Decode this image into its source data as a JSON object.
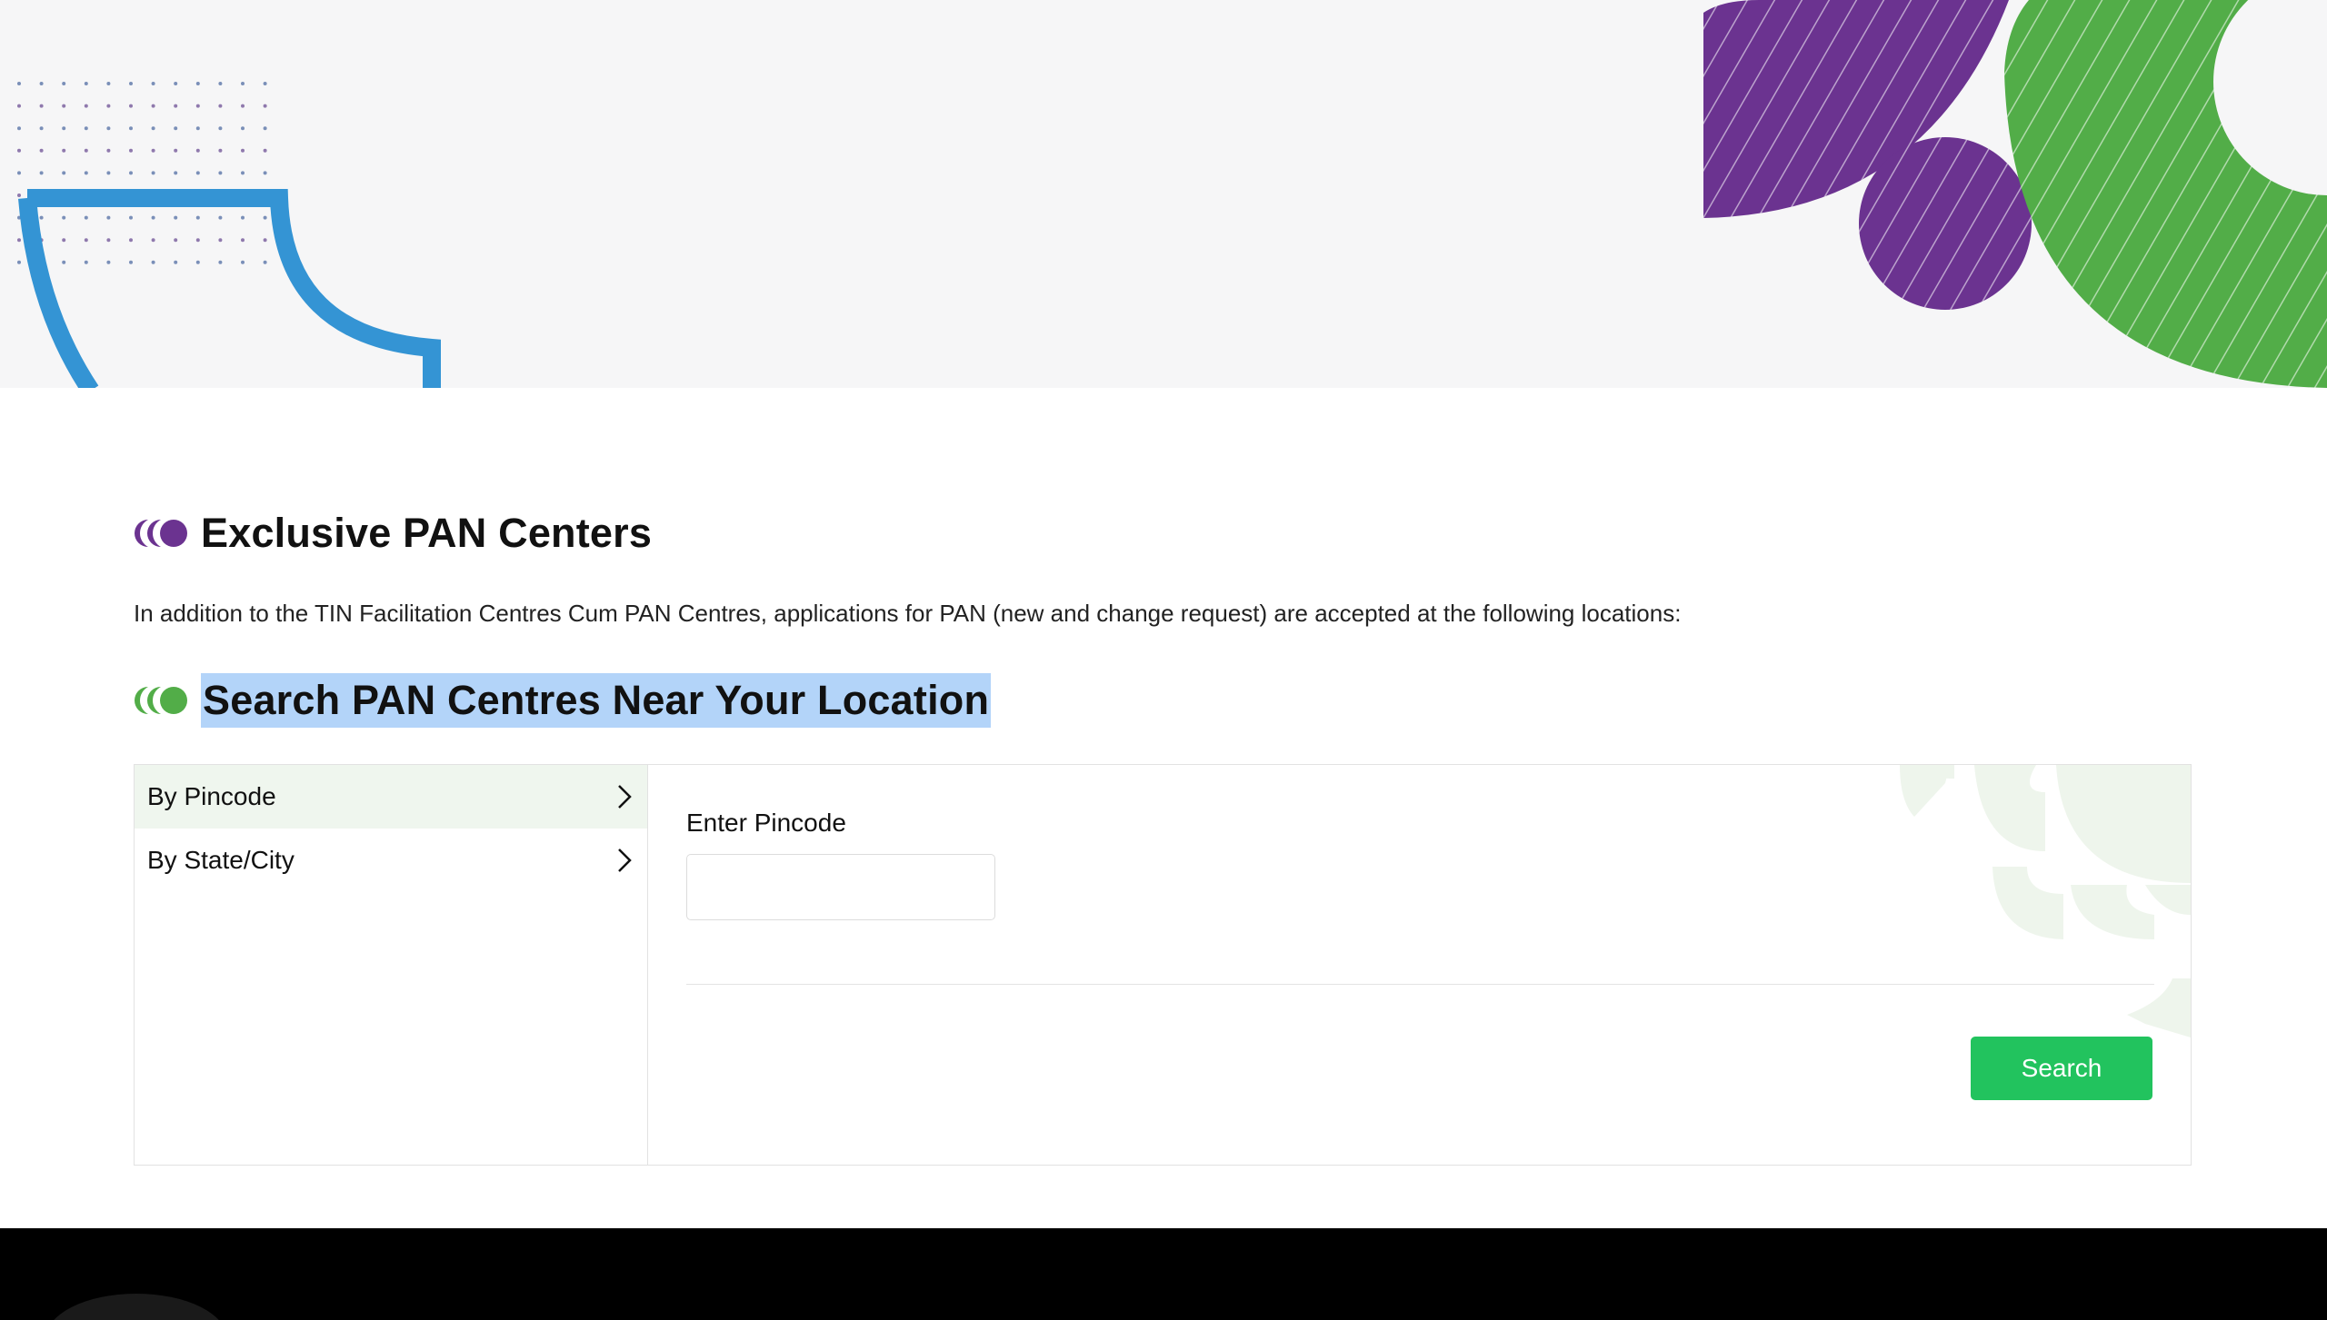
{
  "colors": {
    "brand_blue": "#3494d4",
    "brand_purple": "#6b3390",
    "brand_green": "#52ad48",
    "button_green": "#22c35e",
    "selection": "#b3d4f9"
  },
  "section1": {
    "title": "Exclusive PAN Centers",
    "description": "In addition to the TIN Facilitation Centres Cum PAN Centres, applications for PAN (new and change request) are accepted at the following locations:"
  },
  "section2": {
    "title": "Search PAN Centres Near Your Location"
  },
  "search_panel": {
    "tabs": [
      {
        "label": "By Pincode",
        "active": true,
        "icon": "chevron-right-icon"
      },
      {
        "label": "By State/City",
        "active": false,
        "icon": "chevron-right-icon"
      }
    ],
    "pincode_label": "Enter Pincode",
    "pincode_value": "",
    "search_label": "Search"
  }
}
